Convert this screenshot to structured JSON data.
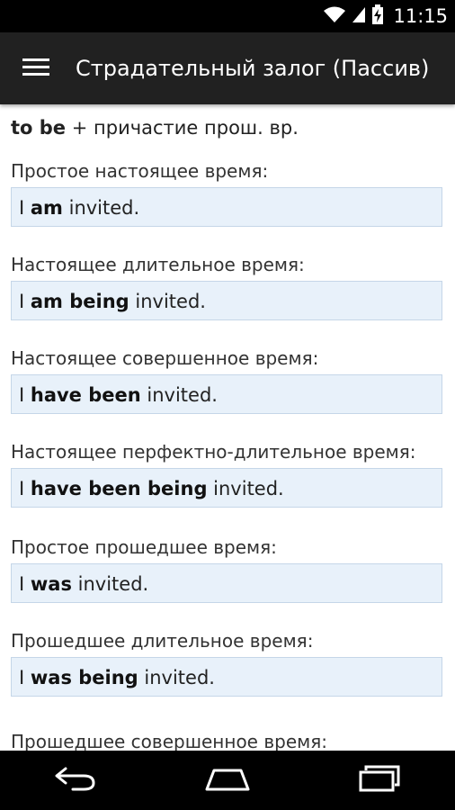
{
  "status_bar": {
    "time": "11:15"
  },
  "app_bar": {
    "title": "Страдательный залог (Пассив)",
    "menu_icon": "hamburger-menu-icon"
  },
  "formula": {
    "bold": "to be",
    "rest": " + причастие прош. вр."
  },
  "sections": [
    {
      "label": "Простое настоящее время:",
      "pre": "I ",
      "bold": "am",
      "post": " invited."
    },
    {
      "label": "Настоящее длительное время:",
      "pre": "I ",
      "bold": "am being",
      "post": " invited."
    },
    {
      "label": "Настоящее совершенное время:",
      "pre": "I ",
      "bold": "have been",
      "post": " invited."
    },
    {
      "label": "Настоящее перфектно-длительное время:",
      "pre": "I ",
      "bold": "have been being",
      "post": " invited."
    },
    {
      "label": "Простое прошедшее время:",
      "pre": "I ",
      "bold": "was",
      "post": " invited."
    },
    {
      "label": "Прошедшее длительное время:",
      "pre": "I ",
      "bold": "was being",
      "post": " invited."
    },
    {
      "label": "Прошедшее совершенное время:",
      "pre": "",
      "bold": "",
      "post": ""
    }
  ],
  "nav_bar": {
    "icons": [
      "back-icon",
      "home-icon",
      "recent-apps-icon"
    ]
  },
  "colors": {
    "app_bar": "#212121",
    "example_bg": "#e8f1fa",
    "example_border": "#c5d6e8"
  }
}
